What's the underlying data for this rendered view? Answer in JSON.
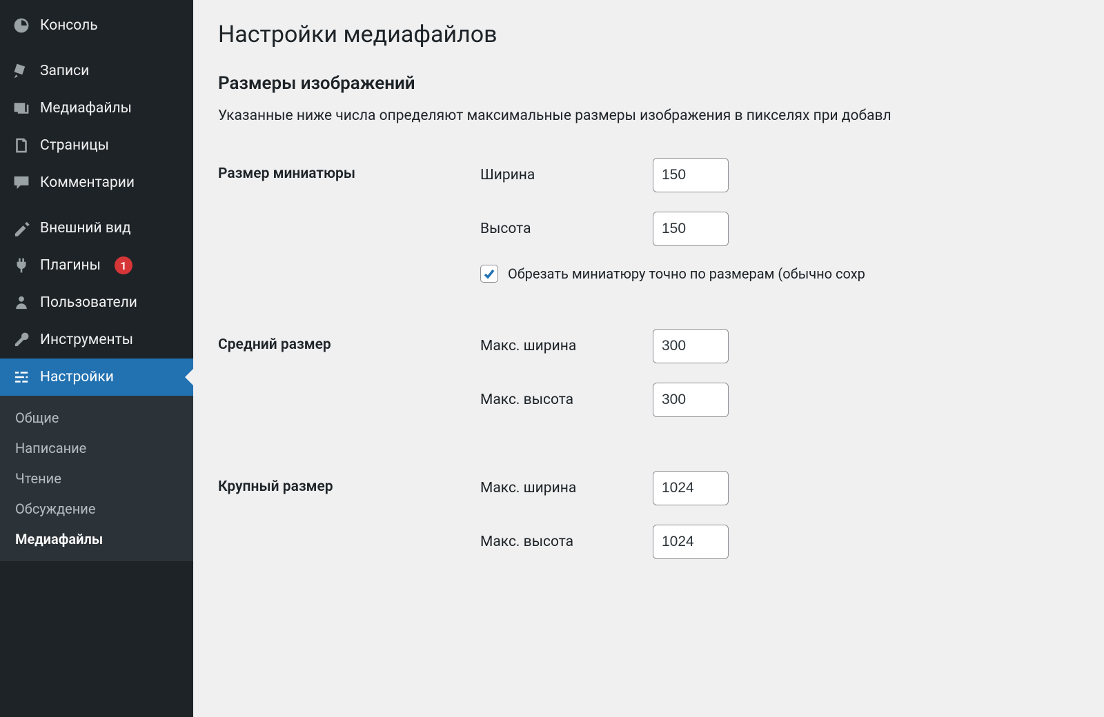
{
  "sidebar": {
    "items": [
      {
        "label": "Консоль",
        "icon": "dashboard"
      },
      {
        "sep": true
      },
      {
        "label": "Записи",
        "icon": "pin"
      },
      {
        "label": "Медиафайлы",
        "icon": "media"
      },
      {
        "label": "Страницы",
        "icon": "pages"
      },
      {
        "label": "Комментарии",
        "icon": "comments"
      },
      {
        "sep": true
      },
      {
        "label": "Внешний вид",
        "icon": "appearance"
      },
      {
        "label": "Плагины",
        "icon": "plugins",
        "badge": "1"
      },
      {
        "label": "Пользователи",
        "icon": "users"
      },
      {
        "label": "Инструменты",
        "icon": "tools"
      },
      {
        "label": "Настройки",
        "icon": "settings",
        "active": true
      }
    ],
    "submenu": [
      {
        "label": "Общие"
      },
      {
        "label": "Написание"
      },
      {
        "label": "Чтение"
      },
      {
        "label": "Обсуждение"
      },
      {
        "label": "Медиафайлы",
        "current": true
      }
    ]
  },
  "page": {
    "title": "Настройки медиафайлов",
    "section_title": "Размеры изображений",
    "description": "Указанные ниже числа определяют максимальные размеры изображения в пикселях при добавл",
    "thumb": {
      "label": "Размер миниатюры",
      "width_label": "Ширина",
      "width_value": "150",
      "height_label": "Высота",
      "height_value": "150",
      "crop_label": "Обрезать миниатюру точно по размерам (обычно сохр",
      "crop_checked": true
    },
    "medium": {
      "label": "Средний размер",
      "width_label": "Макс. ширина",
      "width_value": "300",
      "height_label": "Макс. высота",
      "height_value": "300"
    },
    "large": {
      "label": "Крупный размер",
      "width_label": "Макс. ширина",
      "width_value": "1024",
      "height_label": "Макс. высота",
      "height_value": "1024"
    }
  }
}
